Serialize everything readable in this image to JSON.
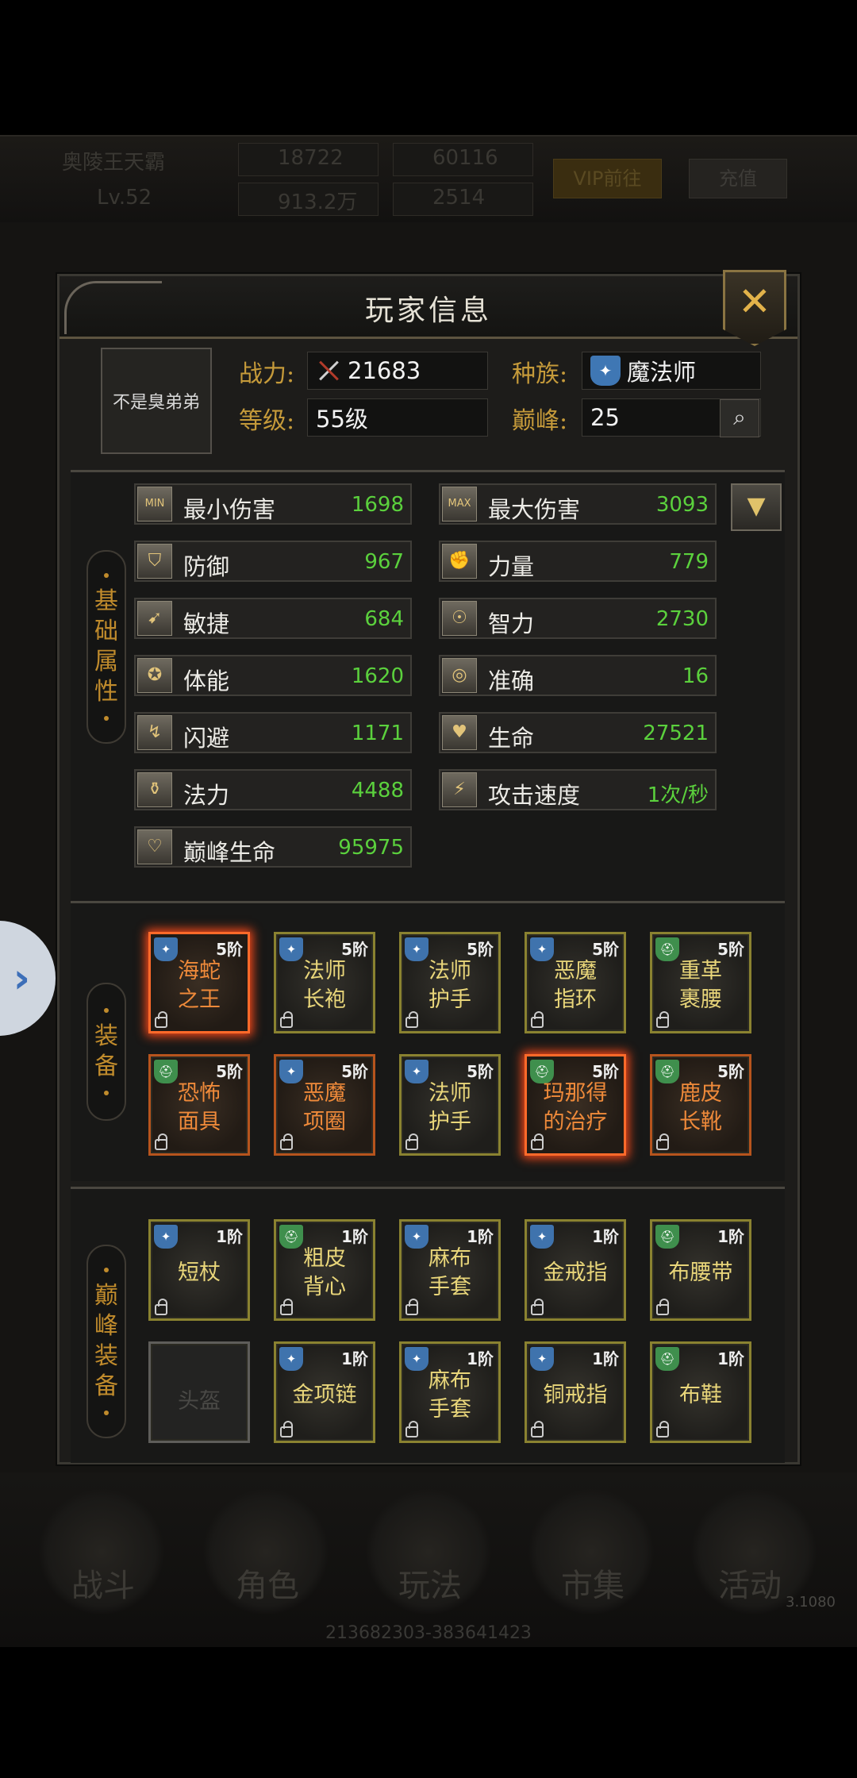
{
  "background": {
    "player_name": "奥陵王天霸",
    "level": "Lv.52",
    "stat1": "18722",
    "stat2": "60116",
    "stat3": "913.2万",
    "stat4": "2514",
    "vip_button": "VIP前往",
    "recharge_button": "充值",
    "nav": [
      "战斗",
      "角色",
      "玩法",
      "市集",
      "活动"
    ],
    "version": "3.1080",
    "bottom_id": "213682303-383641423"
  },
  "side_tab_icon": "chevron-right",
  "dialog": {
    "title": "玩家信息",
    "close_icon": "close-x",
    "player": {
      "name": "不是臭弟弟",
      "power_label": "战力:",
      "power_value": "21683",
      "race_label": "种族:",
      "race_value": "魔法师",
      "level_label": "等级:",
      "level_value": "55级",
      "peak_label": "巅峰:",
      "peak_value": "25"
    },
    "base_section_label": [
      "基",
      "础",
      "属",
      "性"
    ],
    "stats": [
      {
        "name": "最小伤害",
        "value": "1698",
        "icon": "MIN"
      },
      {
        "name": "最大伤害",
        "value": "3093",
        "icon": "MAX"
      },
      {
        "name": "防御",
        "value": "967",
        "icon": "shield"
      },
      {
        "name": "力量",
        "value": "779",
        "icon": "fist"
      },
      {
        "name": "敏捷",
        "value": "684",
        "icon": "boot"
      },
      {
        "name": "智力",
        "value": "2730",
        "icon": "brain"
      },
      {
        "name": "体能",
        "value": "1620",
        "icon": "muscle"
      },
      {
        "name": "准确",
        "value": "16",
        "icon": "target"
      },
      {
        "name": "闪避",
        "value": "1171",
        "icon": "dodge"
      },
      {
        "name": "生命",
        "value": "27521",
        "icon": "heart"
      },
      {
        "name": "法力",
        "value": "4488",
        "icon": "potion"
      },
      {
        "name": "攻击速度",
        "value": "1次/秒",
        "icon": "speed"
      },
      {
        "name": "巅峰生命",
        "value": "95975",
        "icon": "peak-heart"
      }
    ],
    "equip_section_label": [
      "装",
      "备"
    ],
    "equipment": [
      {
        "line1": "海蛇",
        "line2": "之王",
        "tier": "5阶",
        "badge": "blue",
        "rarity": "orange",
        "glow": true
      },
      {
        "line1": "法师",
        "line2": "长袍",
        "tier": "5阶",
        "badge": "blue",
        "rarity": "yellow",
        "glow": false
      },
      {
        "line1": "法师",
        "line2": "护手",
        "tier": "5阶",
        "badge": "blue",
        "rarity": "yellow",
        "glow": false
      },
      {
        "line1": "恶魔",
        "line2": "指环",
        "tier": "5阶",
        "badge": "blue",
        "rarity": "yellow",
        "glow": false
      },
      {
        "line1": "重革",
        "line2": "裹腰",
        "tier": "5阶",
        "badge": "green",
        "rarity": "yellow",
        "glow": false
      },
      {
        "line1": "恐怖",
        "line2": "面具",
        "tier": "5阶",
        "badge": "green",
        "rarity": "orange",
        "glow": false
      },
      {
        "line1": "恶魔",
        "line2": "项圈",
        "tier": "5阶",
        "badge": "blue",
        "rarity": "orange",
        "glow": false
      },
      {
        "line1": "法师",
        "line2": "护手",
        "tier": "5阶",
        "badge": "blue",
        "rarity": "yellow",
        "glow": false
      },
      {
        "line1": "玛那得",
        "line2": "的治疗",
        "tier": "5阶",
        "badge": "green",
        "rarity": "orange",
        "glow": true
      },
      {
        "line1": "鹿皮",
        "line2": "长靴",
        "tier": "5阶",
        "badge": "green",
        "rarity": "orange",
        "glow": false
      }
    ],
    "peak_section_label": [
      "巅",
      "峰",
      "装",
      "备"
    ],
    "peak_equipment": [
      {
        "line1": "短杖",
        "line2": "",
        "tier": "1阶",
        "badge": "blue",
        "empty": false
      },
      {
        "line1": "粗皮",
        "line2": "背心",
        "tier": "1阶",
        "badge": "green",
        "empty": false
      },
      {
        "line1": "麻布",
        "line2": "手套",
        "tier": "1阶",
        "badge": "blue",
        "empty": false
      },
      {
        "line1": "金戒指",
        "line2": "",
        "tier": "1阶",
        "badge": "blue",
        "empty": false
      },
      {
        "line1": "布腰带",
        "line2": "",
        "tier": "1阶",
        "badge": "green",
        "empty": false
      },
      {
        "line1": "头盔",
        "line2": "",
        "tier": "",
        "badge": "",
        "empty": true
      },
      {
        "line1": "金项链",
        "line2": "",
        "tier": "1阶",
        "badge": "blue",
        "empty": false
      },
      {
        "line1": "麻布",
        "line2": "手套",
        "tier": "1阶",
        "badge": "blue",
        "empty": false
      },
      {
        "line1": "铜戒指",
        "line2": "",
        "tier": "1阶",
        "badge": "blue",
        "empty": false
      },
      {
        "line1": "布鞋",
        "line2": "",
        "tier": "1阶",
        "badge": "green",
        "empty": false
      }
    ]
  }
}
